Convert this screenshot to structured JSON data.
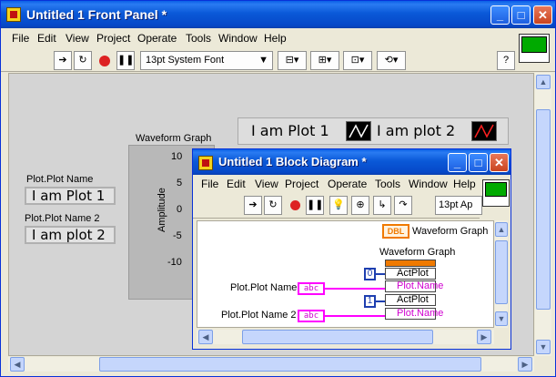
{
  "front_panel": {
    "title": "Untitled 1 Front Panel *",
    "menu": [
      "File",
      "Edit",
      "View",
      "Project",
      "Operate",
      "Tools",
      "Window",
      "Help"
    ],
    "font_select": "13pt System Font",
    "controls": [
      {
        "label": "Plot.Plot Name",
        "value": "I am Plot 1"
      },
      {
        "label": "Plot.Plot Name 2",
        "value": "I am plot 2"
      }
    ],
    "graph": {
      "title": "Waveform Graph",
      "ylabel": "Amplitude",
      "yticks": [
        "10",
        "5",
        "0",
        "-5",
        "-10"
      ]
    },
    "legend": [
      {
        "name": "I am Plot 1",
        "color": "#ffffff"
      },
      {
        "name": "I am plot 2",
        "color": "#ff2020"
      }
    ]
  },
  "block_diagram": {
    "title": "Untitled 1 Block Diagram *",
    "menu": [
      "File",
      "Edit",
      "View",
      "Project",
      "Operate",
      "Tools",
      "Window",
      "Help"
    ],
    "font_select": "13pt Ap",
    "terminal_dbl": "DBL",
    "terminal_dbl_label": "Waveform Graph",
    "node_title": "Waveform Graph",
    "inputs": [
      {
        "label": "Plot.Plot Name",
        "terminal": "abc"
      },
      {
        "label": "Plot.Plot Name 2",
        "terminal": "abc"
      }
    ],
    "rows": [
      {
        "const": "0",
        "prop": "ActPlot",
        "name": "Plot.Name"
      },
      {
        "const": "1",
        "prop": "ActPlot",
        "name": "Plot.Name"
      }
    ]
  },
  "colors": {
    "titlebar": "#0a59d8",
    "pink_wire": "#ff00ff",
    "blue_wire": "#1e3fb0"
  }
}
